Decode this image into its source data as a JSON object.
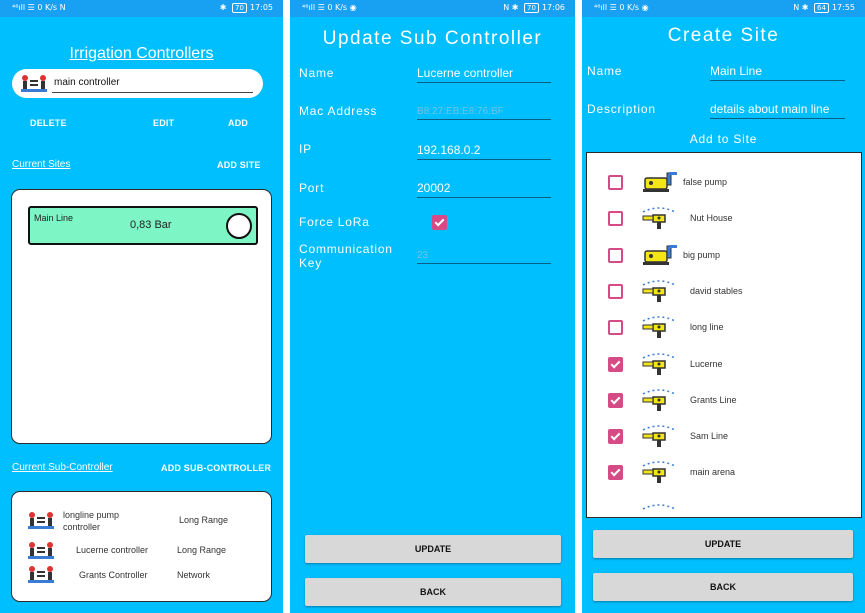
{
  "screen1": {
    "status": {
      "left": "⁴⁶ıll ☰ 0 K/s N",
      "battery": "70",
      "time": "17:05"
    },
    "title": "Irrigation Controllers",
    "selected_controller": "main controller",
    "actions": {
      "delete": "DELETE",
      "edit": "EDIT",
      "add": "ADD"
    },
    "current_sites_link": "Current Sites",
    "add_site_button": "ADD SITE",
    "site": {
      "name": "Main Line",
      "pressure": "0,83 Bar"
    },
    "current_sub_controller_link": "Current Sub-Controller",
    "add_sub_controller_button": "ADD SUB-CONTROLLER",
    "sub_controllers": [
      {
        "name": "longline pump controller",
        "type": "Long Range"
      },
      {
        "name": "Lucerne controller",
        "type": "Long Range"
      },
      {
        "name": "Grants Controller",
        "type": "Network"
      }
    ]
  },
  "screen2": {
    "status": {
      "left": "⁴⁶ıll ☰ 0 K/s ◉",
      "battery": "70",
      "time": "17:06"
    },
    "title": "Update Sub Controller",
    "fields": {
      "name_label": "Name",
      "name_value": "Lucerne controller",
      "mac_label": "Mac Address",
      "mac_value": "B8:27:EB:E8:76:BF",
      "ip_label": "IP",
      "ip_value": "192.168.0.2",
      "port_label": "Port",
      "port_value": "20002",
      "lora_label": "Force LoRa",
      "lora_checked": true,
      "key_label": "Communication Key",
      "key_value": "23"
    },
    "update_button": "UPDATE",
    "back_button": "BACK"
  },
  "screen3": {
    "status": {
      "left": "⁴⁶ıll ☰ 0 K/s ◉",
      "battery": "64",
      "time": "17:55"
    },
    "title": "Create Site",
    "name_label": "Name",
    "name_value": "Main Line",
    "description_label": "Description",
    "description_value": "details about main line",
    "add_to_site_label": "Add to Site",
    "items": [
      {
        "name": "false pump",
        "checked": false,
        "icon": "pump-icon"
      },
      {
        "name": "Nut House",
        "checked": false,
        "icon": "sprinkler-icon"
      },
      {
        "name": "big pump",
        "checked": false,
        "icon": "pump-icon"
      },
      {
        "name": "david stables",
        "checked": false,
        "icon": "sprinkler-icon"
      },
      {
        "name": "long line",
        "checked": false,
        "icon": "sprinkler-icon"
      },
      {
        "name": "Lucerne",
        "checked": true,
        "icon": "sprinkler-icon"
      },
      {
        "name": "Grants Line",
        "checked": true,
        "icon": "sprinkler-icon"
      },
      {
        "name": "Sam Line",
        "checked": true,
        "icon": "sprinkler-icon"
      },
      {
        "name": "main arena",
        "checked": true,
        "icon": "sprinkler-icon"
      }
    ],
    "update_button": "UPDATE",
    "back_button": "BACK"
  },
  "colors": {
    "background": "#00bfff",
    "status_bar": "#18a0f2",
    "checkbox": "#d64b86",
    "site_card": "#7ef5c4"
  }
}
